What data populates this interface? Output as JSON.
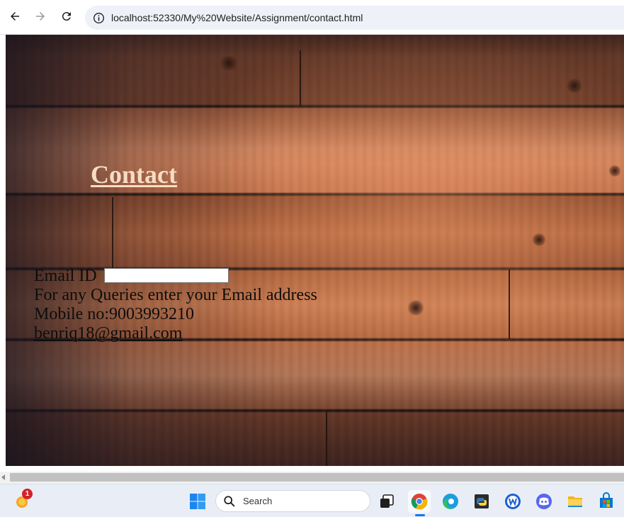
{
  "browser": {
    "url": "localhost:52330/My%20Website/Assignment/contact.html"
  },
  "page": {
    "heading": "Contact",
    "email_label": "Email ID",
    "email_value": "",
    "queries_text": "For any Queries enter your Email address",
    "mobile_text": "Mobile no:9003993210",
    "email_link": "benriq18@gmail.com"
  },
  "taskbar": {
    "search_placeholder": "Search",
    "weather_badge": "1",
    "apps": [
      "start-icon",
      "search-icon",
      "task-view-icon",
      "chrome-icon",
      "edge-icon",
      "python-icon",
      "wordpad-icon",
      "discord-icon",
      "file-explorer-icon",
      "microsoft-store-icon"
    ]
  },
  "colors": {
    "heading": "#f7dcc4",
    "body_text": "#0d0d0d",
    "taskbar": "#e9eef6",
    "accent": "#1a73e8"
  }
}
